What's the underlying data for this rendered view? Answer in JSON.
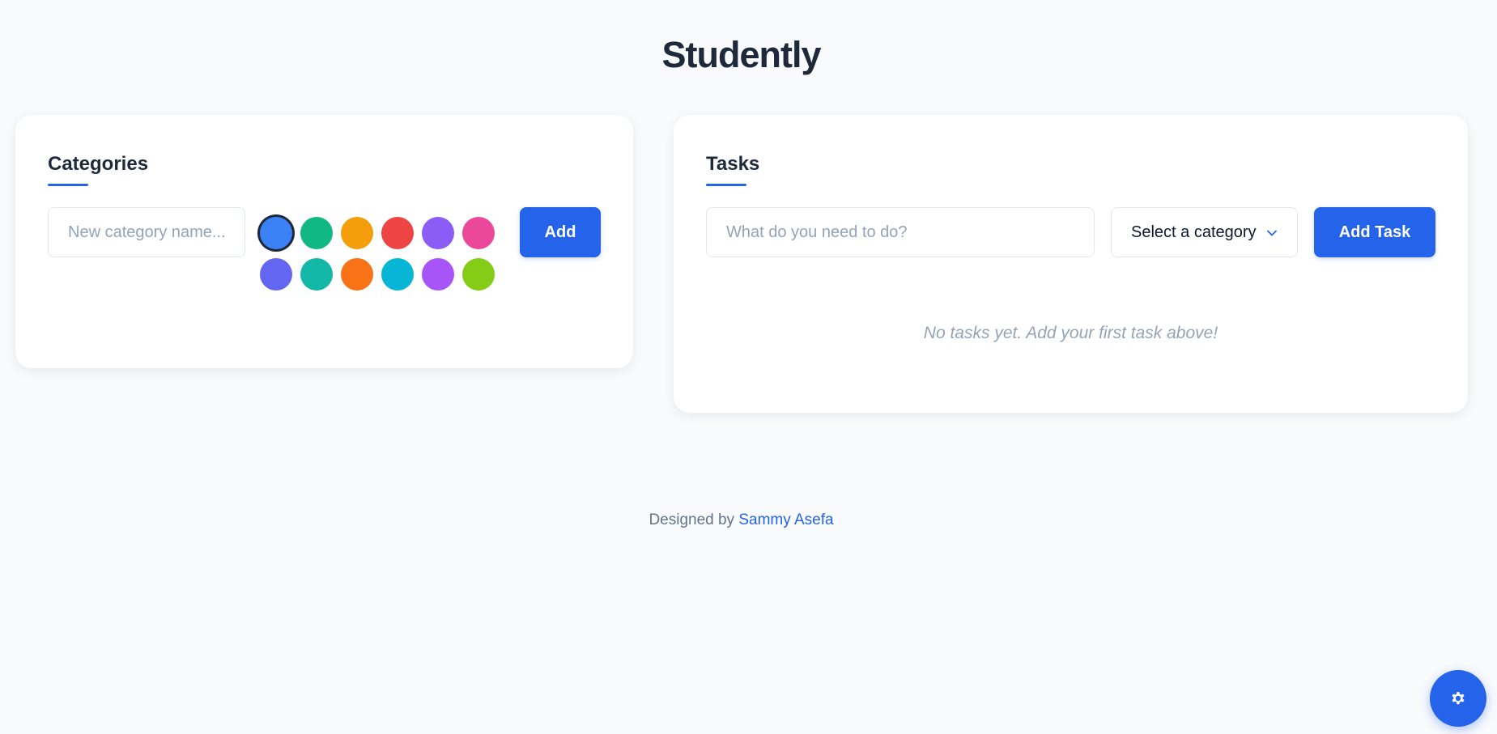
{
  "app": {
    "title": "Studently"
  },
  "categories": {
    "title": "Categories",
    "input_placeholder": "New category name...",
    "add_label": "Add",
    "swatches": [
      {
        "color": "#3b82f6",
        "selected": true
      },
      {
        "color": "#10b981",
        "selected": false
      },
      {
        "color": "#f59e0b",
        "selected": false
      },
      {
        "color": "#ef4444",
        "selected": false
      },
      {
        "color": "#8b5cf6",
        "selected": false
      },
      {
        "color": "#ec4899",
        "selected": false
      },
      {
        "color": "#6366f1",
        "selected": false
      },
      {
        "color": "#14b8a6",
        "selected": false
      },
      {
        "color": "#f97316",
        "selected": false
      },
      {
        "color": "#06b6d4",
        "selected": false
      },
      {
        "color": "#a855f7",
        "selected": false
      },
      {
        "color": "#84cc16",
        "selected": false
      }
    ]
  },
  "tasks": {
    "title": "Tasks",
    "input_placeholder": "What do you need to do?",
    "category_select": "Select a category",
    "add_label": "Add Task",
    "empty_message": "No tasks yet. Add your first task above!"
  },
  "footer": {
    "prefix": "Designed by",
    "author": "Sammy Asefa"
  },
  "settings": {
    "icon": "gear-icon"
  },
  "colors": {
    "accent": "#2563eb",
    "text": "#1e293b",
    "muted": "#94a3b8",
    "background": "#f8fafc"
  }
}
